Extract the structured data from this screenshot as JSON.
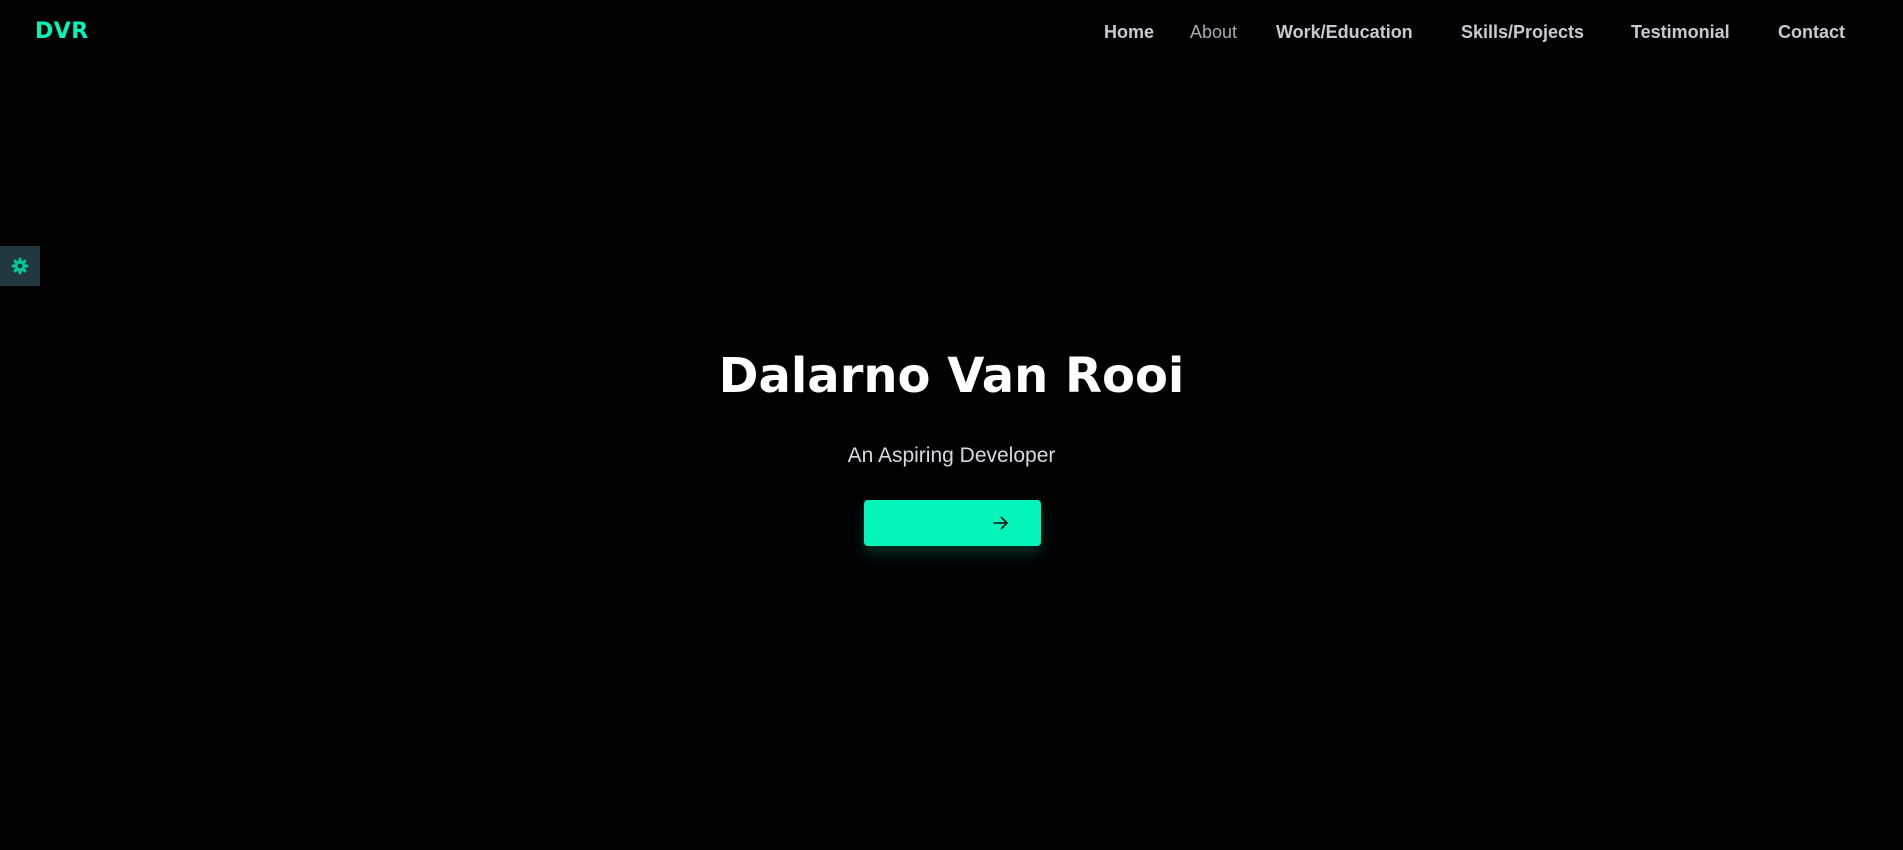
{
  "colors": {
    "background": "#020203",
    "accent": "#04f5b9",
    "nav_text": "#c9cacd",
    "settings_bg": "#233740"
  },
  "header": {
    "logo": "DVR",
    "nav": [
      {
        "label": "Home"
      },
      {
        "label": "About"
      },
      {
        "label": "Work/Education"
      },
      {
        "label": "Skills/Projects"
      },
      {
        "label": "Testimonial"
      },
      {
        "label": "Contact"
      }
    ]
  },
  "settings": {
    "icon": "gear-icon"
  },
  "hero": {
    "title": "Dalarno Van Rooi",
    "subtitle": "An Aspiring Developer",
    "cta_icon": "arrow-right-icon"
  }
}
